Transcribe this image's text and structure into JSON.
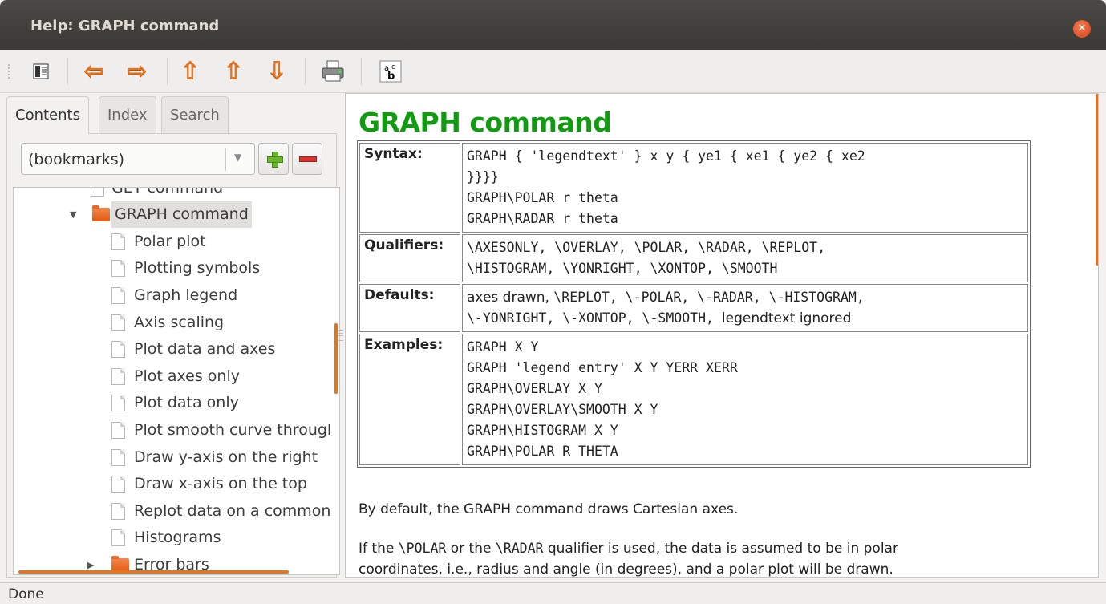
{
  "window": {
    "title": "Help: GRAPH command",
    "close_icon": "close-icon"
  },
  "toolbar": {
    "buttons": [
      {
        "icon": "toggle-sidebar-icon"
      },
      {
        "icon": "back-arrow-icon",
        "glyph": "⇦"
      },
      {
        "icon": "forward-arrow-icon",
        "glyph": "⇨"
      },
      {
        "icon": "up-arrow-icon",
        "glyph": "⇧"
      },
      {
        "icon": "previous-arrow-icon",
        "glyph": "⇧"
      },
      {
        "icon": "next-arrow-icon",
        "glyph": "⇩"
      },
      {
        "icon": "print-icon"
      },
      {
        "icon": "font-size-icon"
      }
    ]
  },
  "sidebar": {
    "tabs": [
      "Contents",
      "Index",
      "Search"
    ],
    "active_tab": "Contents",
    "bookmarks": {
      "selected": "(bookmarks)"
    },
    "tree": {
      "cut_item": "GET command",
      "current": "GRAPH command",
      "children": [
        "Polar plot",
        "Plotting symbols",
        "Graph legend",
        "Axis scaling",
        "Plot data and axes",
        "Plot axes only",
        "Plot data only",
        "Plot smooth curve througl",
        "Draw y-axis on the right",
        "Draw x-axis on the top",
        "Replot data on a common",
        "Histograms"
      ],
      "next_folder": "Error bars"
    }
  },
  "content": {
    "title": "GRAPH command",
    "rows": {
      "syntax": {
        "label": "Syntax:",
        "lines": [
          "GRAPH { 'legendtext' } x y { ye1 { xe1 { ye2 { xe2",
          "}}}}",
          "GRAPH\\POLAR r theta",
          "GRAPH\\RADAR r theta"
        ]
      },
      "qualifiers": {
        "label": "Qualifiers:",
        "lines": [
          "\\AXESONLY, \\OVERLAY, \\POLAR, \\RADAR, \\REPLOT,",
          "\\HISTOGRAM, \\YONRIGHT, \\XONTOP, \\SMOOTH"
        ]
      },
      "defaults": {
        "label": "Defaults:",
        "line1_a": "axes drawn, ",
        "line1_b": "\\REPLOT, \\-POLAR, \\-RADAR, \\-HISTOGRAM,",
        "line2_a": "\\-YONRIGHT, \\-XONTOP, \\-SMOOTH, ",
        "line2_b": "legendtext ignored"
      },
      "examples": {
        "label": "Examples:",
        "lines": [
          "GRAPH X Y",
          "GRAPH 'legend entry' X Y YERR XERR",
          "GRAPH\\OVERLAY X Y",
          "GRAPH\\OVERLAY\\SMOOTH X Y",
          "GRAPH\\HISTOGRAM X Y",
          "GRAPH\\POLAR R THETA"
        ]
      }
    },
    "para1": "By default, the GRAPH command draws Cartesian axes.",
    "para2_a": "If the ",
    "para2_b": "\\POLAR",
    "para2_c": " or the ",
    "para2_d": "\\RADAR",
    "para2_e": " qualifier is used, the data is assumed to be in polar",
    "para2_line2": "coordinates, i.e., radius and angle (in degrees), and a polar plot will be drawn."
  },
  "status": {
    "text": "Done"
  },
  "colors": {
    "accent": "#e8731c",
    "title_green": "#119b11"
  }
}
